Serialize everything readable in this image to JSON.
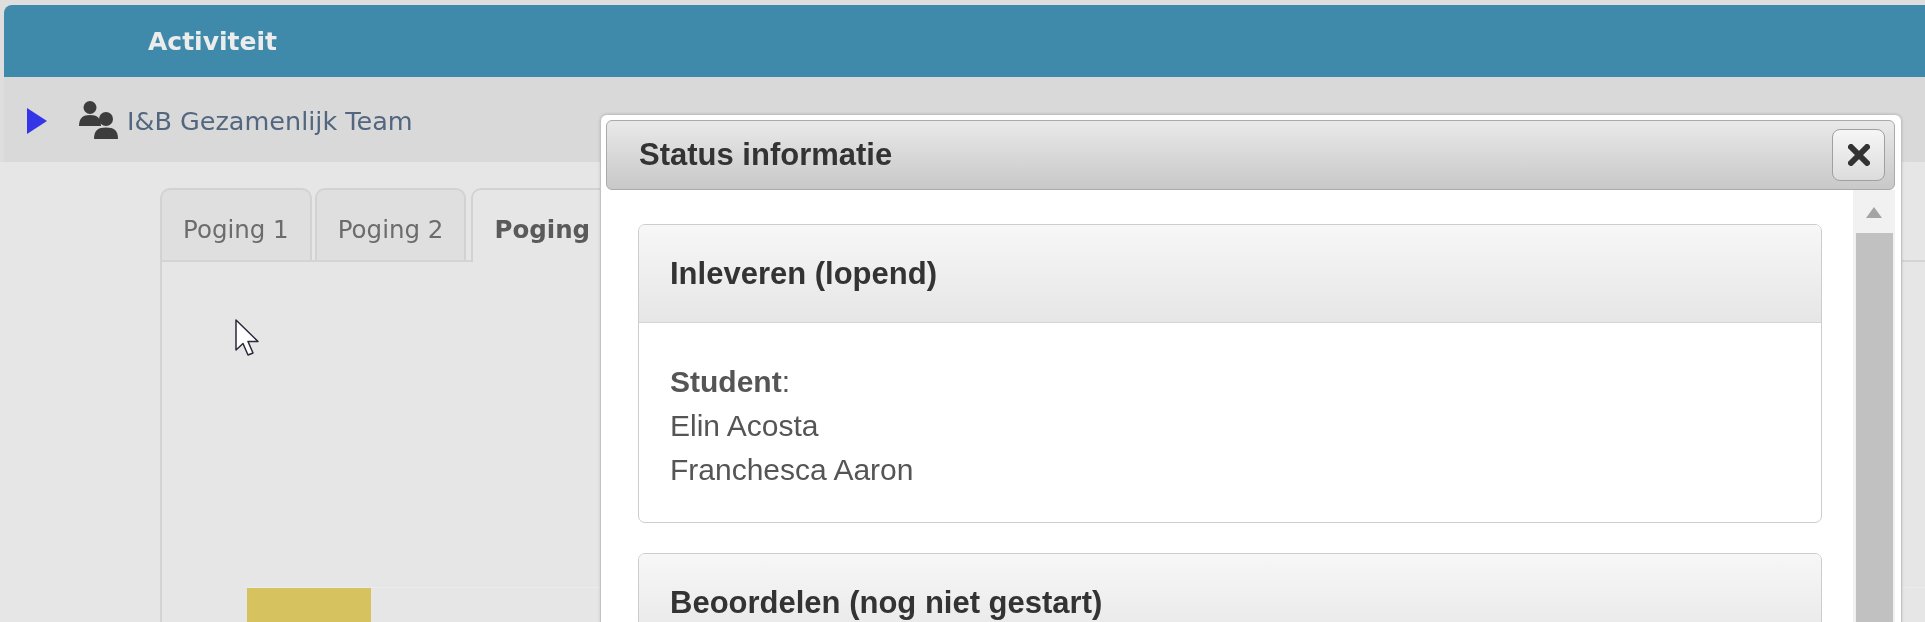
{
  "header": {
    "title": "Activiteit"
  },
  "team": {
    "expanded": false,
    "name": "I&B Gezamenlijk Team"
  },
  "tabs": [
    {
      "label": "Poging 1",
      "selected": false
    },
    {
      "label": "Poging 2",
      "selected": false
    },
    {
      "label": "Poging",
      "selected": true
    }
  ],
  "dialog": {
    "title": "Status informatie",
    "sections": [
      {
        "title": "Inleveren (lopend)",
        "label": "**Student**:",
        "lines": [
          "Elin Acosta",
          "Franchesca Aaron"
        ]
      },
      {
        "title": "Beoordelen (nog niet gestart)"
      }
    ]
  }
}
